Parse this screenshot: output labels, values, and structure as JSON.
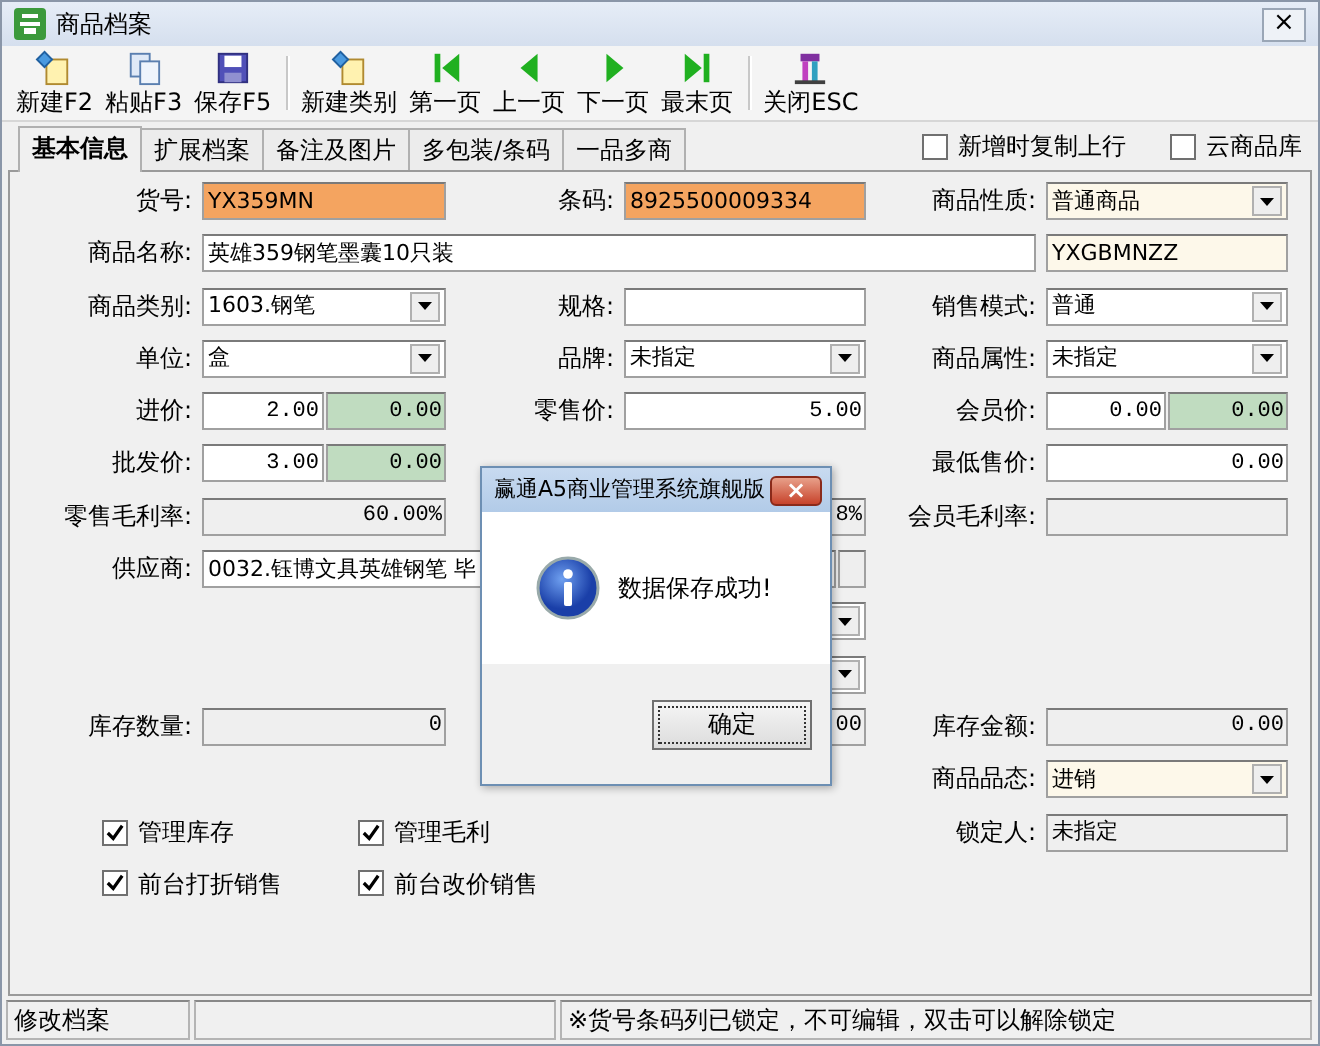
{
  "window": {
    "title": "商品档案",
    "close": "×"
  },
  "toolbar": [
    [
      {
        "label": "新建F2",
        "kind": "new"
      },
      {
        "label": "粘贴F3",
        "kind": "paste"
      },
      {
        "label": "保存F5",
        "kind": "save"
      }
    ],
    [
      {
        "label": "新建类别",
        "kind": "new"
      },
      {
        "label": "第一页",
        "kind": "first"
      },
      {
        "label": "上一页",
        "kind": "prev"
      },
      {
        "label": "下一页",
        "kind": "next"
      },
      {
        "label": "最末页",
        "kind": "last"
      }
    ],
    [
      {
        "label": "关闭ESC",
        "kind": "exit"
      }
    ]
  ],
  "tabs": [
    {
      "label": "基本信息",
      "selected": true
    },
    {
      "label": "扩展档案",
      "selected": false
    },
    {
      "label": "备注及图片",
      "selected": false
    },
    {
      "label": "多包装/条码",
      "selected": false
    },
    {
      "label": "一品多商",
      "selected": false
    }
  ],
  "options": [
    {
      "label": "新增时复制上行",
      "checked": false
    },
    {
      "label": "云商品库",
      "checked": false
    }
  ],
  "form": [
    {
      "left": {
        "label": "货号:",
        "field": {
          "kind": "locked",
          "value": "YX359MN"
        }
      },
      "middle": {
        "label": "条码:",
        "field": {
          "kind": "locked",
          "value": "8925500009334"
        }
      },
      "right": {
        "label": "商品性质:",
        "field": {
          "kind": "cream-combo",
          "value": "普通商品"
        }
      }
    },
    {
      "left": {
        "label": "商品名称:",
        "field": {
          "kind": "wide",
          "value": "英雄359钢笔墨囊10只装"
        }
      },
      "right": {
        "field": {
          "kind": "cream",
          "value": "YXGBMNZZ"
        }
      }
    },
    {
      "left": {
        "label": "商品类别:",
        "field": {
          "kind": "combo",
          "value": "1603.钢笔"
        }
      },
      "middle": {
        "label": "规格:",
        "field": {
          "kind": "text"
        }
      },
      "right": {
        "label": "销售模式:",
        "field": {
          "kind": "combo",
          "value": "普通"
        }
      }
    },
    {
      "left": {
        "label": "单位:",
        "field": {
          "kind": "combo",
          "value": "盒"
        }
      },
      "middle": {
        "label": "品牌:",
        "field": {
          "kind": "combo",
          "value": "未指定"
        }
      },
      "right": {
        "label": "商品属性:",
        "field": {
          "kind": "combo",
          "value": "未指定"
        }
      }
    },
    {
      "left": {
        "label": "进价:",
        "field": {
          "kind": "price",
          "value": "2.00",
          "extra": "0.00"
        }
      },
      "middle": {
        "label": "零售价:",
        "field": {
          "kind": "number",
          "value": "5.00"
        }
      },
      "right": {
        "label": "会员价:",
        "field": {
          "kind": "price",
          "value": "0.00",
          "extra": "0.00"
        }
      }
    },
    {
      "left": {
        "label": "批发价:",
        "field": {
          "kind": "price",
          "value": "3.00",
          "extra": "0.00"
        }
      },
      "right": {
        "label": "最低售价:",
        "field": {
          "kind": "number",
          "value": "0.00"
        }
      }
    },
    {
      "left": {
        "label": "零售毛利率:",
        "field": {
          "kind": "readonly-number",
          "value": "60.00%"
        }
      },
      "middle": {
        "field": {
          "kind": "readonly-number",
          "value": "8%"
        }
      },
      "right": {
        "label": "会员毛利率:",
        "field": {
          "kind": "readonly"
        }
      }
    },
    {
      "left": {
        "label": "供应商:",
        "field": {
          "kind": "supplier",
          "value": "0032.钰博文具英雄钢笔 毕"
        }
      }
    },
    {
      "middle": {
        "field": {
          "kind": "combo"
        }
      }
    },
    {
      "middle": {
        "field": {
          "kind": "combo"
        }
      }
    },
    {
      "left": {
        "label": "库存数量:",
        "field": {
          "kind": "readonly-number",
          "value": "0"
        }
      },
      "middle": {
        "field": {
          "kind": "readonly-number",
          "value": "00"
        }
      },
      "right": {
        "label": "库存金额:",
        "field": {
          "kind": "readonly-number",
          "value": "0.00"
        }
      }
    },
    {
      "right": {
        "label": "商品品态:",
        "field": {
          "kind": "cream-combo",
          "value": "进销"
        }
      }
    },
    {
      "checks": [
        {
          "label": "管理库存",
          "checked": true
        },
        {
          "label": "管理毛利",
          "checked": true
        }
      ],
      "right": {
        "label": "锁定人:",
        "field": {
          "kind": "readonly",
          "value": "未指定"
        }
      }
    },
    {
      "checks": [
        {
          "label": "前台打折销售",
          "checked": true
        },
        {
          "label": "前台改价销售",
          "checked": true
        }
      ]
    }
  ],
  "status_bar": [
    "修改档案",
    "※货号条码列已锁定，不可编辑，双击可以解除锁定"
  ],
  "dialog": {
    "title": "赢通A5商业管理系统旗舰版",
    "close": "×",
    "message": "数据保存成功!",
    "button": "确定"
  }
}
